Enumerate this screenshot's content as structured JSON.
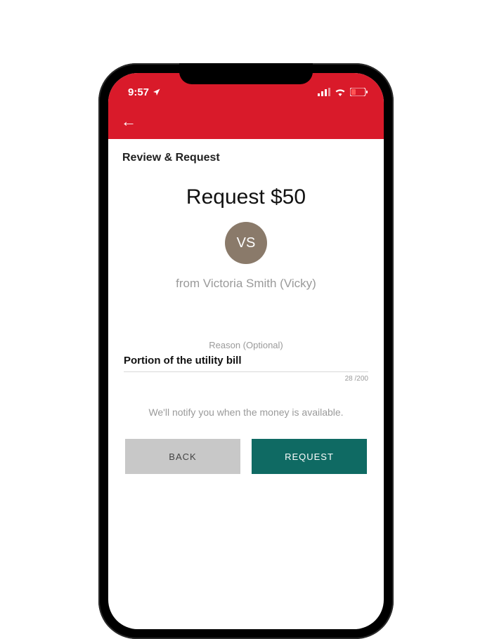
{
  "status": {
    "time": "9:57",
    "location_icon": "location",
    "signal_icon": "signal",
    "wifi_icon": "wifi",
    "battery_icon": "battery-low"
  },
  "nav": {
    "back_icon": "←"
  },
  "page": {
    "title": "Review & Request",
    "amount_label": "Request $50",
    "avatar_initials": "VS",
    "from_line": "from Victoria Smith (Vicky)",
    "reason_label": "Reason (Optional)",
    "reason_value": "Portion of the utility bill",
    "char_count": "28 /200",
    "note": "We'll notify you when the money is available."
  },
  "buttons": {
    "back": "BACK",
    "request": "REQUEST"
  },
  "colors": {
    "brand_red": "#d91a2a",
    "avatar_bg": "#8a7a6a",
    "primary_btn": "#0f6a63",
    "secondary_btn": "#c8c8c8"
  }
}
